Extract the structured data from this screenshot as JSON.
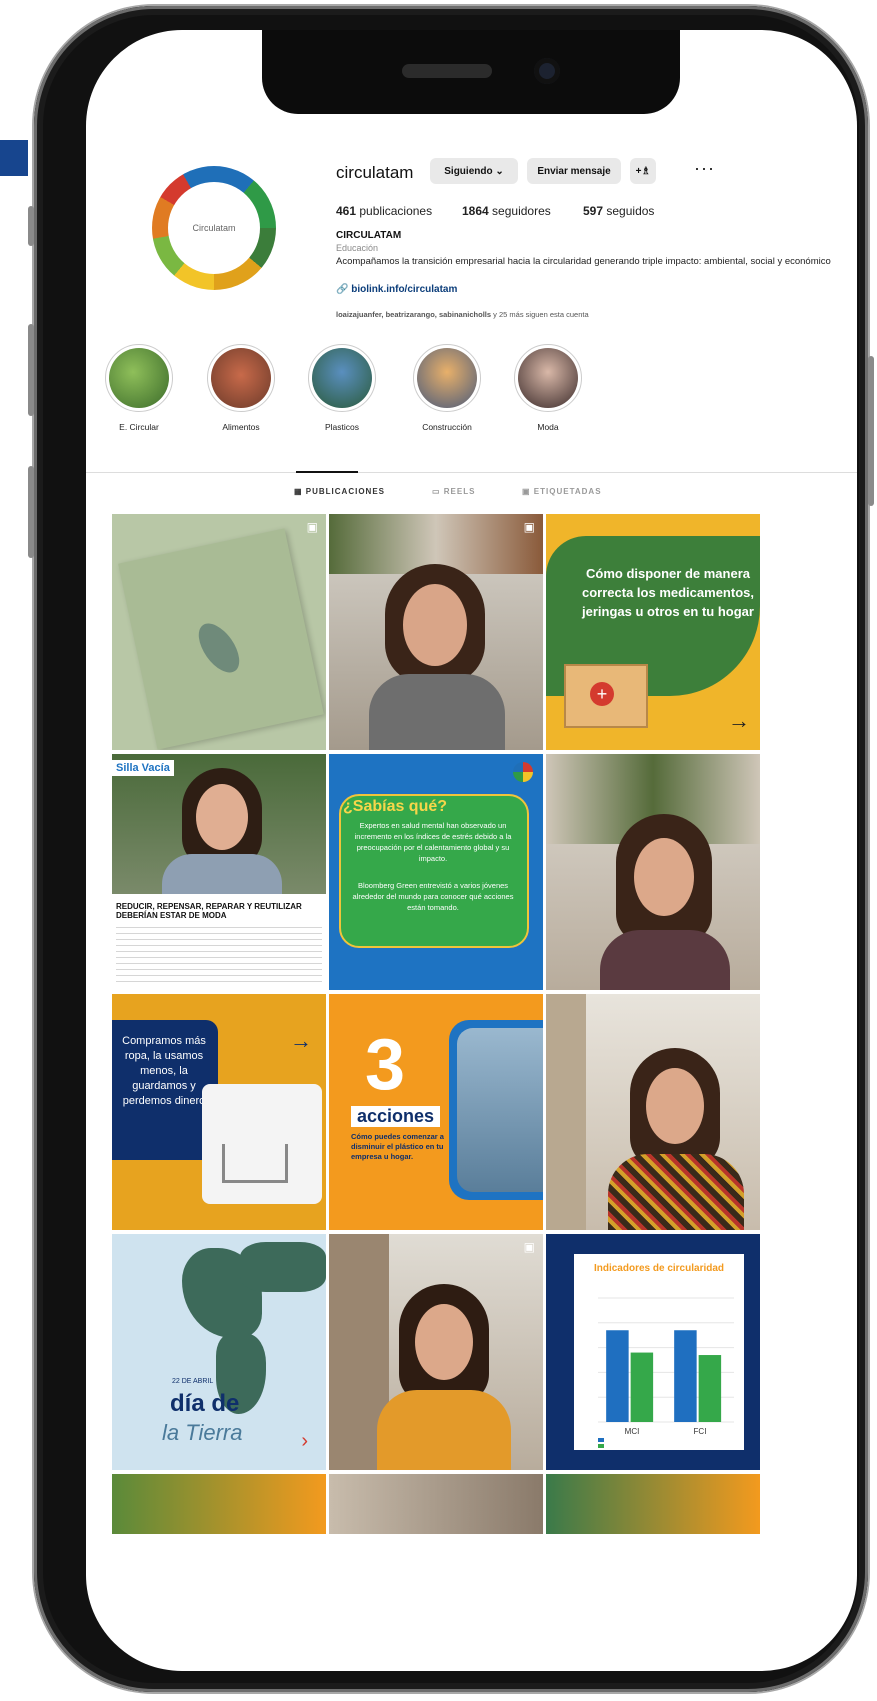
{
  "profile": {
    "username": "circulatam",
    "following_label": "Siguiendo ⌄",
    "message_label": "Enviar mensaje",
    "add_user_icon": "+♗",
    "more_label": "···",
    "stats": {
      "posts": "461",
      "posts_label": "publicaciones",
      "followers": "1864",
      "followers_label": "seguidores",
      "following": "597",
      "following_label": "seguidos"
    },
    "display_name": "CIRCULATAM",
    "category": "Educación",
    "bio": "Acompañamos la transición empresarial hacia la circularidad generando triple impacto: ambiental, social y económico",
    "link": "biolink.info/circulatam",
    "followed_by": "loaizajuanfer, beatrizarango, sabinanicholls",
    "followed_by_suffix": "y 25 más siguen esta cuenta",
    "avatar_text": "Circulatam"
  },
  "highlights": [
    {
      "label": "E. Circular"
    },
    {
      "label": "Alimentos"
    },
    {
      "label": "Plasticos"
    },
    {
      "label": "Construcción"
    },
    {
      "label": "Moda"
    }
  ],
  "tabs": [
    {
      "label": "PUBLICACIONES"
    },
    {
      "label": "REELS"
    },
    {
      "label": "ETIQUETADAS"
    }
  ],
  "posts": {
    "medicamentos": "Cómo disponer de manera correcta los medicamentos, jeringas u otros en tu hogar",
    "silla_vacia": "Silla Vacía",
    "silla_headline": "REDUCIR, REPENSAR, REPARAR Y REUTILIZAR DEBERÍAN ESTAR DE MODA",
    "sabias_title": "¿Sabías qué?",
    "sabias_body": "Expertos en salud mental han observado un incremento en los índices de estrés debido a la preocupación por el calentamiento global y su impacto.",
    "sabias_body2": "Bloomberg Green entrevistó a varios jóvenes alrededor del mundo para conocer qué acciones están tomando.",
    "ropa": "Compramos más ropa, la usamos menos, la guardamos y perdemos dinero",
    "tres_num": "3",
    "tres_word": "acciones",
    "tres_sub": "Cómo puedes comenzar a disminuir el plástico en tu empresa u hogar.",
    "tierra_date": "22 DE ABRIL",
    "tierra_title": "día de",
    "tierra_script": "la Tierra",
    "indicadores_title": "Indicadores de circularidad",
    "indicadores_labels": [
      "MCI",
      "FCI"
    ]
  },
  "chart_data": {
    "type": "bar",
    "title": "Indicadores de circularidad",
    "categories": [
      "MCI",
      "FCI"
    ],
    "series": [
      {
        "values": [
          0.74,
          0.74
        ]
      },
      {
        "values": [
          0.56,
          0.54
        ]
      }
    ],
    "ylim": [
      0,
      1
    ],
    "colors": [
      "#1f6fc0",
      "#35a84a"
    ]
  },
  "colors": {
    "green_post": "#3d7f3a",
    "yellow": "#f0b52a",
    "blue_post": "#1e73c2",
    "navy": "#0f2f6b",
    "orange": "#f39a1e",
    "map_bg": "#cfe3ef"
  }
}
